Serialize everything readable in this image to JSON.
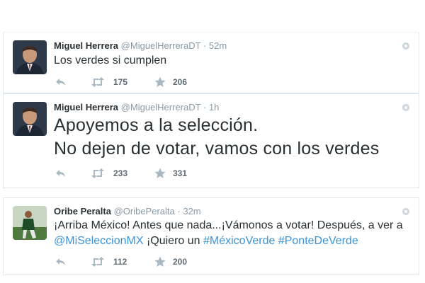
{
  "tweets": [
    {
      "name": "Miguel Herrera",
      "handle": "@MiguelHerreraDT",
      "separator": "·",
      "time": "52m",
      "text": "Los verdes si cumplen",
      "retweets": "175",
      "favorites": "206"
    },
    {
      "name": "Miguel Herrera",
      "handle": "@MiguelHerreraDT",
      "separator": "·",
      "time": "1h",
      "line1": "Apoyemos a la selección.",
      "line2": "No dejen de votar, vamos con los verdes",
      "retweets": "233",
      "favorites": "331"
    },
    {
      "name": "Oribe Peralta",
      "handle": "@OribePeralta",
      "separator": "·",
      "time": "32m",
      "text_part1": "¡Arriba México! Antes que nada...¡Vámonos a votar! Después, a ver a",
      "mention": "@MiSeleccionMX",
      "text_part2": " ¡Quiero un ",
      "hashtag1": "#MéxicoVerde",
      "hashtag2": "#PonteDeVerde",
      "retweets": "112",
      "favorites": "200"
    }
  ],
  "icons": {
    "reply": "reply-icon",
    "retweet": "retweet-icon",
    "favorite": "star-icon",
    "settings": "gear-icon"
  },
  "colors": {
    "link": "#3b94d9",
    "meta": "#8899a6",
    "action": "#aab8c2",
    "border": "#e1e8ed"
  }
}
